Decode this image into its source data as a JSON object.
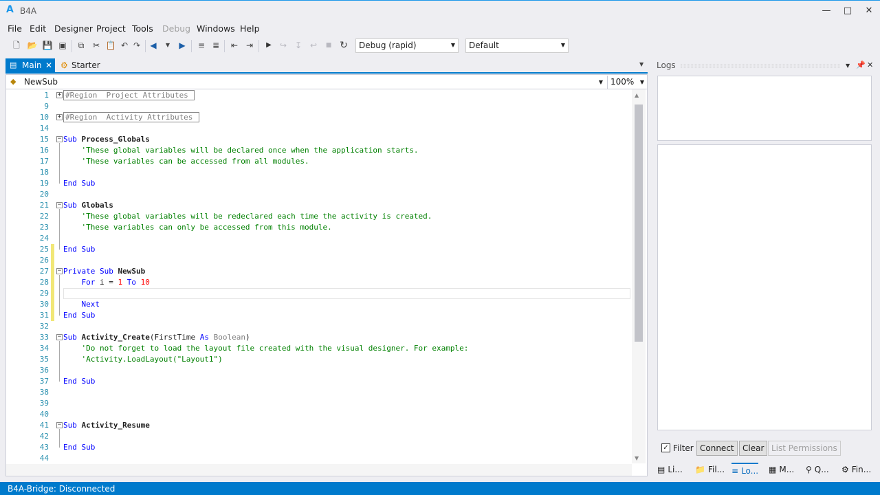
{
  "window": {
    "title": "B4A",
    "icon": "A"
  },
  "menu": [
    "File",
    "Edit",
    "Designer",
    "Project",
    "Tools",
    "Debug",
    "Windows",
    "Help"
  ],
  "toolbar": {
    "mode": "Debug (rapid)",
    "device": "Default"
  },
  "tabs": {
    "main": "Main",
    "starter": "Starter"
  },
  "editor": {
    "sub_selector": "NewSub",
    "zoom": "100%"
  },
  "code_lines": [
    {
      "n": "1",
      "t": "region",
      "text": "#Region  Project Attributes "
    },
    {
      "n": "9",
      "t": "blank"
    },
    {
      "n": "10",
      "t": "region",
      "text": "#Region  Activity Attributes "
    },
    {
      "n": "14",
      "t": "blank"
    },
    {
      "n": "15",
      "t": "sub",
      "kw": "Sub",
      "name": "Process_Globals"
    },
    {
      "n": "16",
      "t": "comment",
      "text": "'These global variables will be declared once when the application starts."
    },
    {
      "n": "17",
      "t": "comment",
      "text": "'These variables can be accessed from all modules."
    },
    {
      "n": "18",
      "t": "blank"
    },
    {
      "n": "19",
      "t": "end",
      "text": "End Sub"
    },
    {
      "n": "20",
      "t": "blank"
    },
    {
      "n": "21",
      "t": "sub",
      "kw": "Sub",
      "name": "Globals"
    },
    {
      "n": "22",
      "t": "comment",
      "text": "'These global variables will be redeclared each time the activity is created."
    },
    {
      "n": "23",
      "t": "comment",
      "text": "'These variables can only be accessed from this module."
    },
    {
      "n": "24",
      "t": "blank"
    },
    {
      "n": "25",
      "t": "end",
      "text": "End Sub"
    },
    {
      "n": "26",
      "t": "blank"
    },
    {
      "n": "27",
      "t": "sub",
      "kw": "Private Sub",
      "name": "NewSub"
    },
    {
      "n": "28",
      "t": "for",
      "kw1": "For",
      "var": "i =",
      "start": "1",
      "kw2": "To",
      "end": "10"
    },
    {
      "n": "29",
      "t": "blank"
    },
    {
      "n": "30",
      "t": "next",
      "text": "Next"
    },
    {
      "n": "31",
      "t": "end",
      "text": "End Sub"
    },
    {
      "n": "32",
      "t": "blank"
    },
    {
      "n": "33",
      "t": "subargs",
      "kw": "Sub",
      "name": "Activity_Create",
      "open": "(FirstTime ",
      "as": "As",
      "type": "Boolean",
      "close": ")"
    },
    {
      "n": "34",
      "t": "comment",
      "text": "'Do not forget to load the layout file created with the visual designer. For example:"
    },
    {
      "n": "35",
      "t": "comment",
      "text": "'Activity.LoadLayout(\"Layout1\")"
    },
    {
      "n": "36",
      "t": "blank"
    },
    {
      "n": "37",
      "t": "end",
      "text": "End Sub"
    },
    {
      "n": "38",
      "t": "blank"
    },
    {
      "n": "39",
      "t": "blank"
    },
    {
      "n": "40",
      "t": "blank"
    },
    {
      "n": "41",
      "t": "sub",
      "kw": "Sub",
      "name": "Activity_Resume"
    },
    {
      "n": "42",
      "t": "blank"
    },
    {
      "n": "43",
      "t": "end",
      "text": "End Sub"
    },
    {
      "n": "44",
      "t": "blank"
    }
  ],
  "logs": {
    "title": "Logs",
    "filter": "Filter",
    "connect": "Connect",
    "clear": "Clear",
    "permissions": "List Permissions"
  },
  "bottom_tabs": [
    "Li...",
    "Fil...",
    "Lo...",
    "M...",
    "Q...",
    "Fin..."
  ],
  "status": "B4A-Bridge: Disconnected"
}
